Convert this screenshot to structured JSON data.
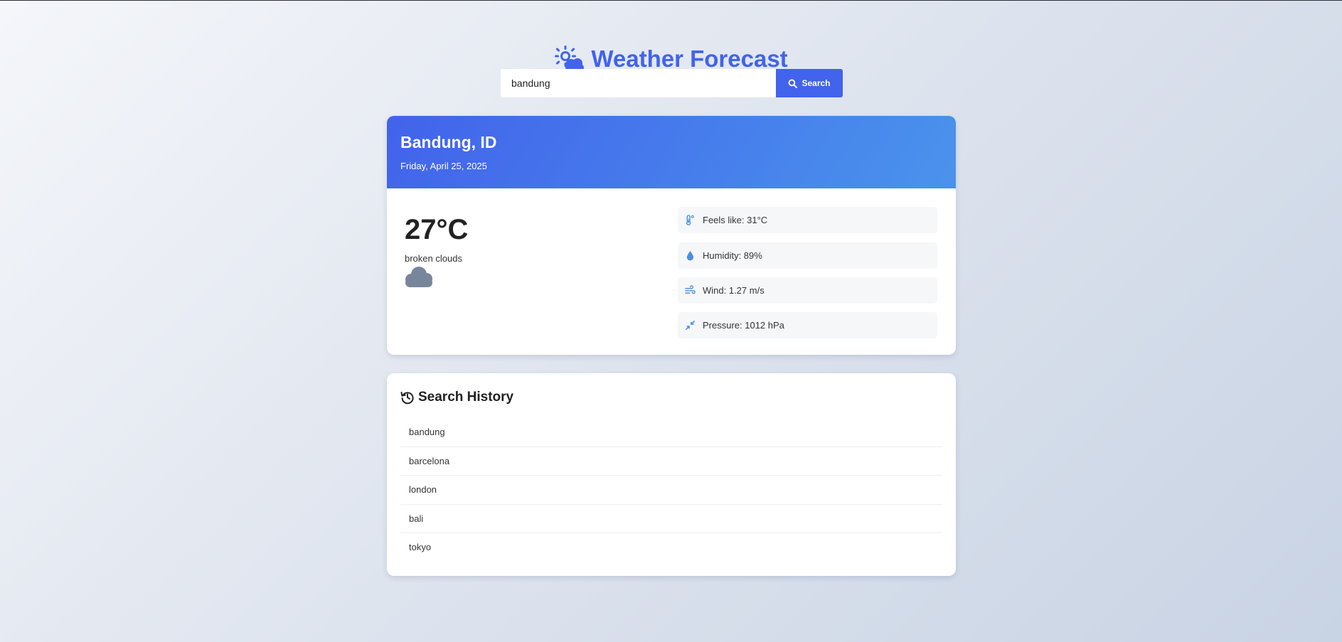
{
  "app": {
    "title": "Weather Forecast",
    "icon": "sun-cloud-icon",
    "accent_color": "#4263eb"
  },
  "search": {
    "value": "bandung",
    "button_label": "Search",
    "button_icon": "search-icon"
  },
  "weather": {
    "location": "Bandung, ID",
    "date": "Friday, April 25, 2025",
    "temperature": "27°C",
    "description": "broken clouds",
    "condition_icon": "cloud-icon",
    "details": [
      {
        "icon": "thermometer-icon",
        "text": "Feels like: 31°C"
      },
      {
        "icon": "droplet-icon",
        "text": "Humidity: 89%"
      },
      {
        "icon": "wind-icon",
        "text": "Wind: 1.27 m/s"
      },
      {
        "icon": "compress-icon",
        "text": "Pressure: 1012 hPa"
      }
    ]
  },
  "history": {
    "title": "Search History",
    "icon": "history-icon",
    "items": [
      "bandung",
      "barcelona",
      "london",
      "bali",
      "tokyo"
    ]
  }
}
